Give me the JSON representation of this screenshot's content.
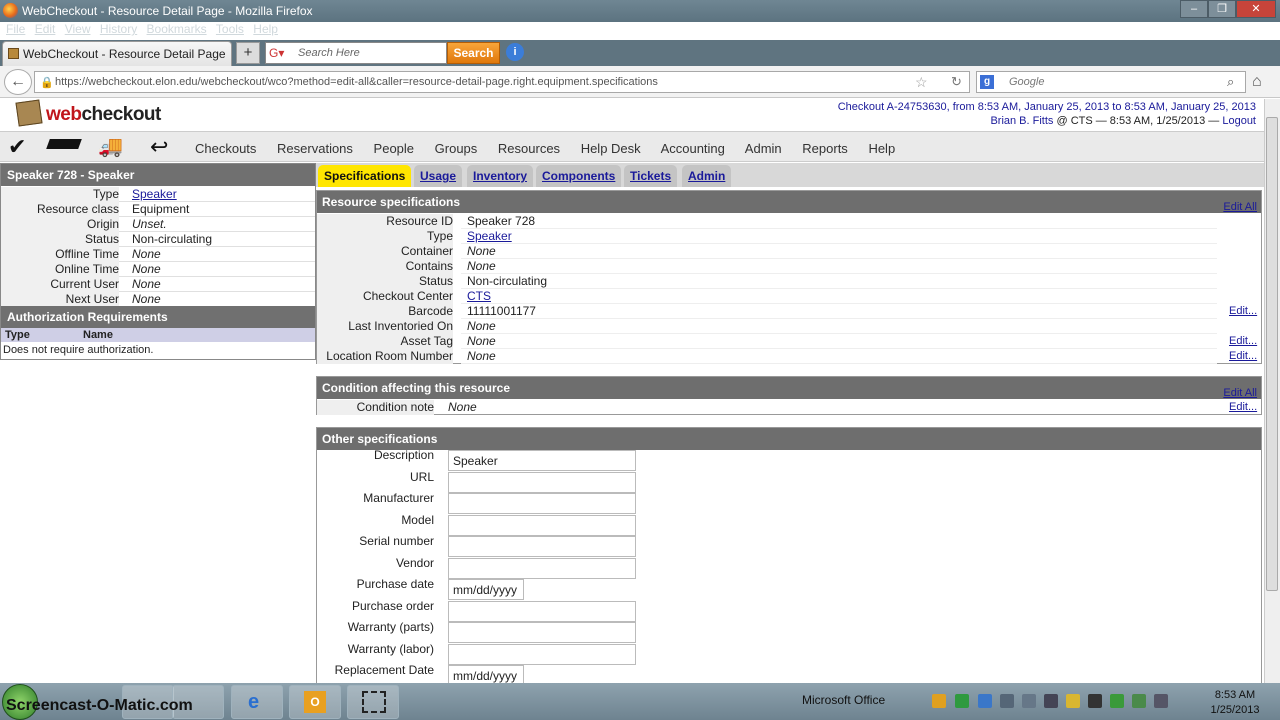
{
  "window": {
    "title": "WebCheckout - Resource Detail Page - Mozilla Firefox",
    "menu": [
      "File",
      "Edit",
      "View",
      "History",
      "Bookmarks",
      "Tools",
      "Help"
    ]
  },
  "browser": {
    "tab_title": "WebCheckout - Resource Detail Page",
    "newtab_label": "+",
    "search_placeholder": "Search Here",
    "search_button": "Search",
    "url": "https://webcheckout.elon.edu/webcheckout/wco?method=edit-all&caller=resource-detail-page.right.equipment.specifications",
    "search_engine_text": "Google"
  },
  "header": {
    "logo_web": "web",
    "logo_checkout": "checkout",
    "checkout_link": "Checkout A-24753630, from 8:53 AM, January 25, 2013 to 8:53 AM, January 25, 2013",
    "user_link": "Brian B. Fitts",
    "user_info": "@ CTS — 8:53 AM, 1/25/2013 —",
    "logout": "Logout"
  },
  "appnav": [
    "Checkouts",
    "Reservations",
    "People",
    "Groups",
    "Resources",
    "Help Desk",
    "Accounting",
    "Admin",
    "Reports",
    "Help"
  ],
  "left": {
    "title": "Speaker 728 - Speaker",
    "rows": [
      {
        "k": "Type",
        "v": "Speaker"
      },
      {
        "k": "Resource class",
        "v": "Equipment"
      },
      {
        "k": "Origin",
        "v": "Unset."
      },
      {
        "k": "Status",
        "v": "Non-circulating"
      },
      {
        "k": "Offline Time",
        "v": "None"
      },
      {
        "k": "Online Time",
        "v": "None"
      },
      {
        "k": "Current User",
        "v": "None"
      },
      {
        "k": "Next User",
        "v": "None"
      }
    ],
    "auth_title": "Authorization Requirements",
    "auth_col_type": "Type",
    "auth_col_name": "Name",
    "auth_text": "Does not require authorization."
  },
  "tabs": [
    "Specifications",
    "Usage",
    "Inventory",
    "Components",
    "Tickets",
    "Admin"
  ],
  "specs": {
    "title": "Resource specifications",
    "edit_all": "Edit All",
    "edit": "Edit...",
    "rows": [
      {
        "k": "Resource ID",
        "v": "Speaker 728"
      },
      {
        "k": "Type",
        "v": "Speaker"
      },
      {
        "k": "Container",
        "v": "None"
      },
      {
        "k": "Contains",
        "v": "None"
      },
      {
        "k": "Status",
        "v": "Non-circulating"
      },
      {
        "k": "Checkout Center",
        "v": "CTS"
      },
      {
        "k": "Barcode",
        "v": "11111001177"
      },
      {
        "k": "Last Inventoried On",
        "v": "None"
      },
      {
        "k": "Asset Tag",
        "v": "None"
      },
      {
        "k": "Location Room Number",
        "v": "None"
      }
    ]
  },
  "condition": {
    "title": "Condition affecting this resource",
    "edit_all": "Edit All",
    "label": "Condition note",
    "value": "None",
    "edit": "Edit..."
  },
  "other": {
    "title": "Other specifications",
    "fields": [
      {
        "k": "Description",
        "v": "Speaker"
      },
      {
        "k": "URL",
        "v": ""
      },
      {
        "k": "Manufacturer",
        "v": ""
      },
      {
        "k": "Model",
        "v": ""
      },
      {
        "k": "Serial number",
        "v": ""
      },
      {
        "k": "Vendor",
        "v": ""
      },
      {
        "k": "Purchase date",
        "v": "mm/dd/yyyy"
      },
      {
        "k": "Purchase order",
        "v": ""
      },
      {
        "k": "Warranty (parts)",
        "v": ""
      },
      {
        "k": "Warranty (labor)",
        "v": ""
      },
      {
        "k": "Replacement Date",
        "v": "mm/dd/yyyy"
      }
    ]
  },
  "taskbar": {
    "watermark": "Screencast-O-Matic.com",
    "office_label": "Microsoft Office",
    "time": "8:53 AM",
    "date": "1/25/2013"
  }
}
